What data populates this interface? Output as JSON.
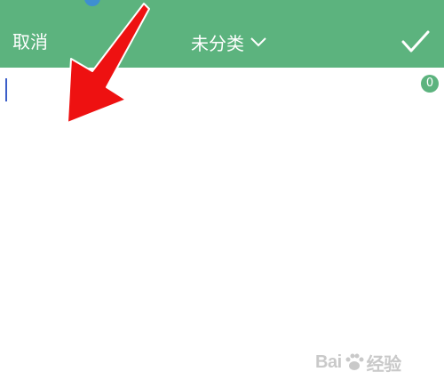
{
  "header": {
    "cancel_label": "取消",
    "category_label": "未分类",
    "category_icon": "chevron-down-icon",
    "confirm_icon": "check-icon",
    "background_color": "#5cb37e"
  },
  "editor": {
    "content": "",
    "char_count": "0"
  },
  "annotation": {
    "arrow_color": "#ee1111"
  },
  "watermark": {
    "text_left": "Bai",
    "text_right": "经验"
  }
}
